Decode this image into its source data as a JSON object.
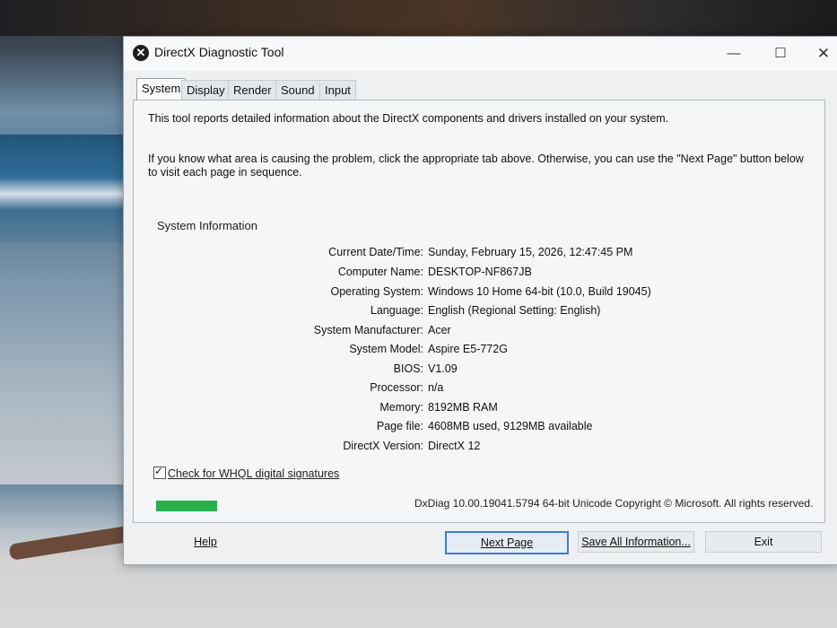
{
  "window": {
    "title": "DirectX Diagnostic Tool",
    "controls": {
      "minimize": "—",
      "maximize": "☐",
      "close": "✕"
    }
  },
  "tabs": [
    "System",
    "Display",
    "Render",
    "Sound",
    "Input"
  ],
  "active_tab": "System",
  "intro": {
    "line1": "This tool reports detailed information about the DirectX components and drivers installed on your system.",
    "line2": "If you know what area is causing the problem, click the appropriate tab above.  Otherwise, you can use the \"Next Page\" button below to visit each page in sequence."
  },
  "system_info": {
    "title": "System Information",
    "rows": [
      {
        "label": "Current Date/Time:",
        "value": "Sunday, February 15, 2026, 12:47:45 PM"
      },
      {
        "label": "Computer Name:",
        "value": "DESKTOP-NF867JB"
      },
      {
        "label": "Operating System:",
        "value": "Windows 10 Home 64-bit (10.0, Build 19045)"
      },
      {
        "label": "Language:",
        "value": "English (Regional Setting: English)"
      },
      {
        "label": "System Manufacturer:",
        "value": "Acer"
      },
      {
        "label": "System Model:",
        "value": "Aspire E5-772G"
      },
      {
        "label": "BIOS:",
        "value": "V1.09"
      },
      {
        "label": "Processor:",
        "value": "n/a"
      },
      {
        "label": "Memory:",
        "value": "8192MB RAM"
      },
      {
        "label": "Page file:",
        "value": "4608MB used, 9129MB available"
      },
      {
        "label": "DirectX Version:",
        "value": "DirectX 12"
      }
    ]
  },
  "whql": {
    "label": "Check for WHQL digital signatures",
    "checked": true
  },
  "progress": {
    "fraction": 1.0,
    "color": "#27b04a"
  },
  "copyright": "DxDiag 10.00.19041.5794 64-bit Unicode  Copyright © Microsoft. All rights reserved.",
  "buttons": {
    "help": "Help",
    "next": "Next Page",
    "save": "Save All Information...",
    "exit": "Exit"
  }
}
